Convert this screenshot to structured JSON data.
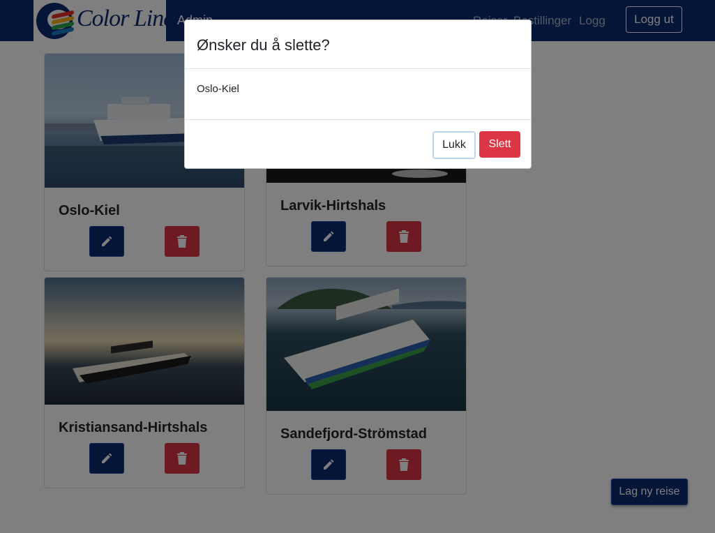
{
  "navbar": {
    "brand_logo_text": "Color Line",
    "brand_title": "Admin",
    "links": [
      "Reiser",
      "Bestillinger",
      "Logg"
    ],
    "logout_label": "Logg ut"
  },
  "routes": [
    {
      "name": "Oslo-Kiel"
    },
    {
      "name": "Larvik-Hirtshals"
    },
    {
      "name": "Kristiansand-Hirtshals"
    },
    {
      "name": "Sandefjord-Strömstad"
    }
  ],
  "new_trip_label": "Lag ny reise",
  "modal": {
    "title": "Ønsker du å slette?",
    "body": "Oslo-Kiel",
    "close_label": "Lukk",
    "delete_label": "Slett"
  },
  "colors": {
    "navy": "#0b2a6e",
    "danger": "#dc3545"
  },
  "icons": {
    "edit": "pencil-icon",
    "delete": "trash-icon"
  }
}
